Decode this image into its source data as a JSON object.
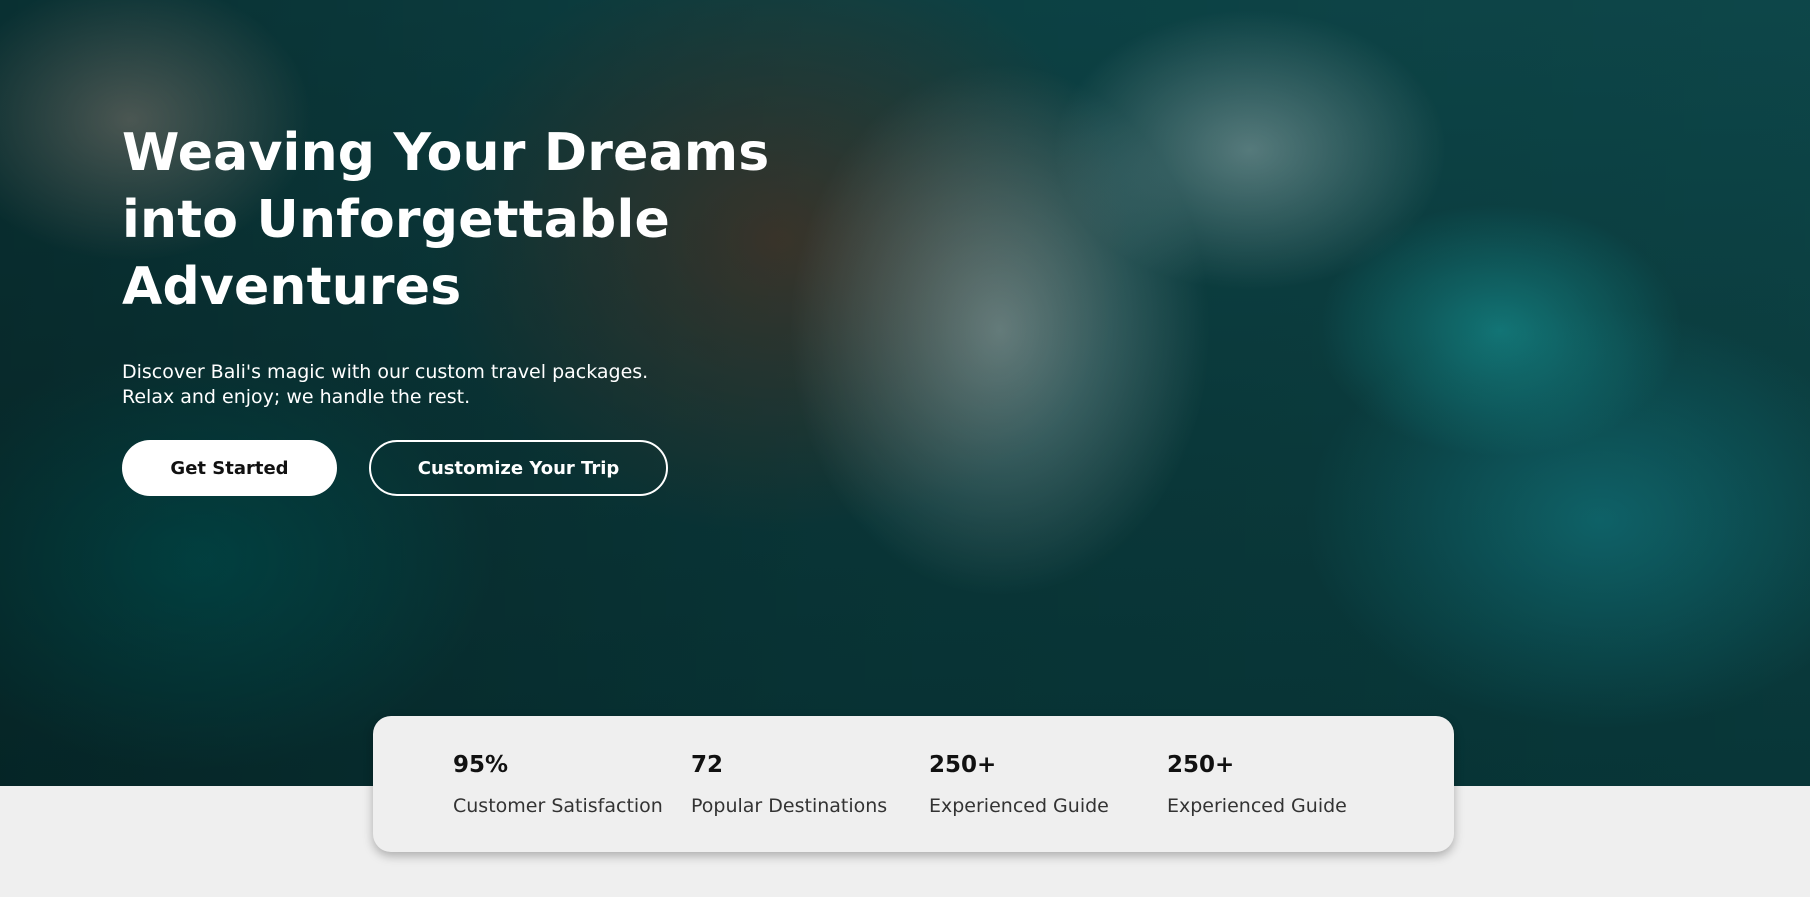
{
  "hero": {
    "title_lines": [
      "Weaving Your Dreams",
      "into Unforgettable",
      "Adventures"
    ],
    "subtitle_lines": [
      "Discover Bali's magic with our custom travel packages.",
      "Relax and enjoy; we handle the rest."
    ],
    "primary_button_label": "Get Started",
    "secondary_button_label": "Customize Your Trip"
  },
  "stats": [
    {
      "value": "95%",
      "label": "Customer Satisfaction"
    },
    {
      "value": "72",
      "label": "Popular Destinations"
    },
    {
      "value": "250+",
      "label": "Experienced Guide"
    },
    {
      "value": "250+",
      "label": "Experienced Guide"
    }
  ]
}
